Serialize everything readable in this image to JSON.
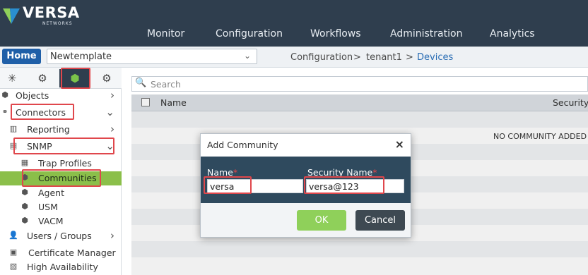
{
  "header": {
    "logo_text": "VERSA",
    "logo_sub": "NETWORKS",
    "nav": [
      "Monitor",
      "Configuration",
      "Workflows",
      "Administration",
      "Analytics"
    ]
  },
  "breadcrumb_bar": {
    "home_label": "Home",
    "org_selected": "Newtemplate",
    "crumbs": [
      "Configuration",
      ">",
      "tenant1",
      ">",
      "Devices"
    ]
  },
  "sidebar": {
    "tabs": [
      "network-icon",
      "gear-icon",
      "cube-icon",
      "settings-badge-icon"
    ],
    "items": [
      {
        "label": "Objects",
        "icon": "cube-icon",
        "arrow": "›"
      },
      {
        "label": "Connectors",
        "icon": "link-icon",
        "arrow": "⌄"
      },
      {
        "label": "Reporting",
        "icon": "chart-icon",
        "arrow": "›"
      },
      {
        "label": "SNMP",
        "icon": "server-icon",
        "arrow": "⌄"
      },
      {
        "label": "Trap Profiles",
        "icon": "doc-icon"
      },
      {
        "label": "Communities",
        "icon": "cube-icon"
      },
      {
        "label": "Agent",
        "icon": "cube-icon"
      },
      {
        "label": "USM",
        "icon": "cube-icon"
      },
      {
        "label": "VACM",
        "icon": "cube-icon"
      },
      {
        "label": "Users / Groups",
        "icon": "user-icon",
        "arrow": "›"
      },
      {
        "label": "Certificate Manager",
        "icon": "certificate-icon"
      },
      {
        "label": "High Availability",
        "icon": "ha-icon"
      }
    ]
  },
  "main": {
    "search_placeholder": "Search",
    "columns": [
      "Name",
      "Security"
    ],
    "empty_message": "NO COMMUNITY ADDED"
  },
  "modal": {
    "title": "Add Community",
    "close": "×",
    "fields": {
      "name_label": "Name",
      "name_value": "versa",
      "security_label": "Security Name",
      "security_value": "versa@123",
      "required_mark": "*"
    },
    "ok_label": "OK",
    "cancel_label": "Cancel"
  },
  "colors": {
    "header_bg": "#2f3e4e",
    "accent_green": "#8bbf4a",
    "home_blue": "#1f5fa8",
    "highlight_red": "#e0474c"
  }
}
